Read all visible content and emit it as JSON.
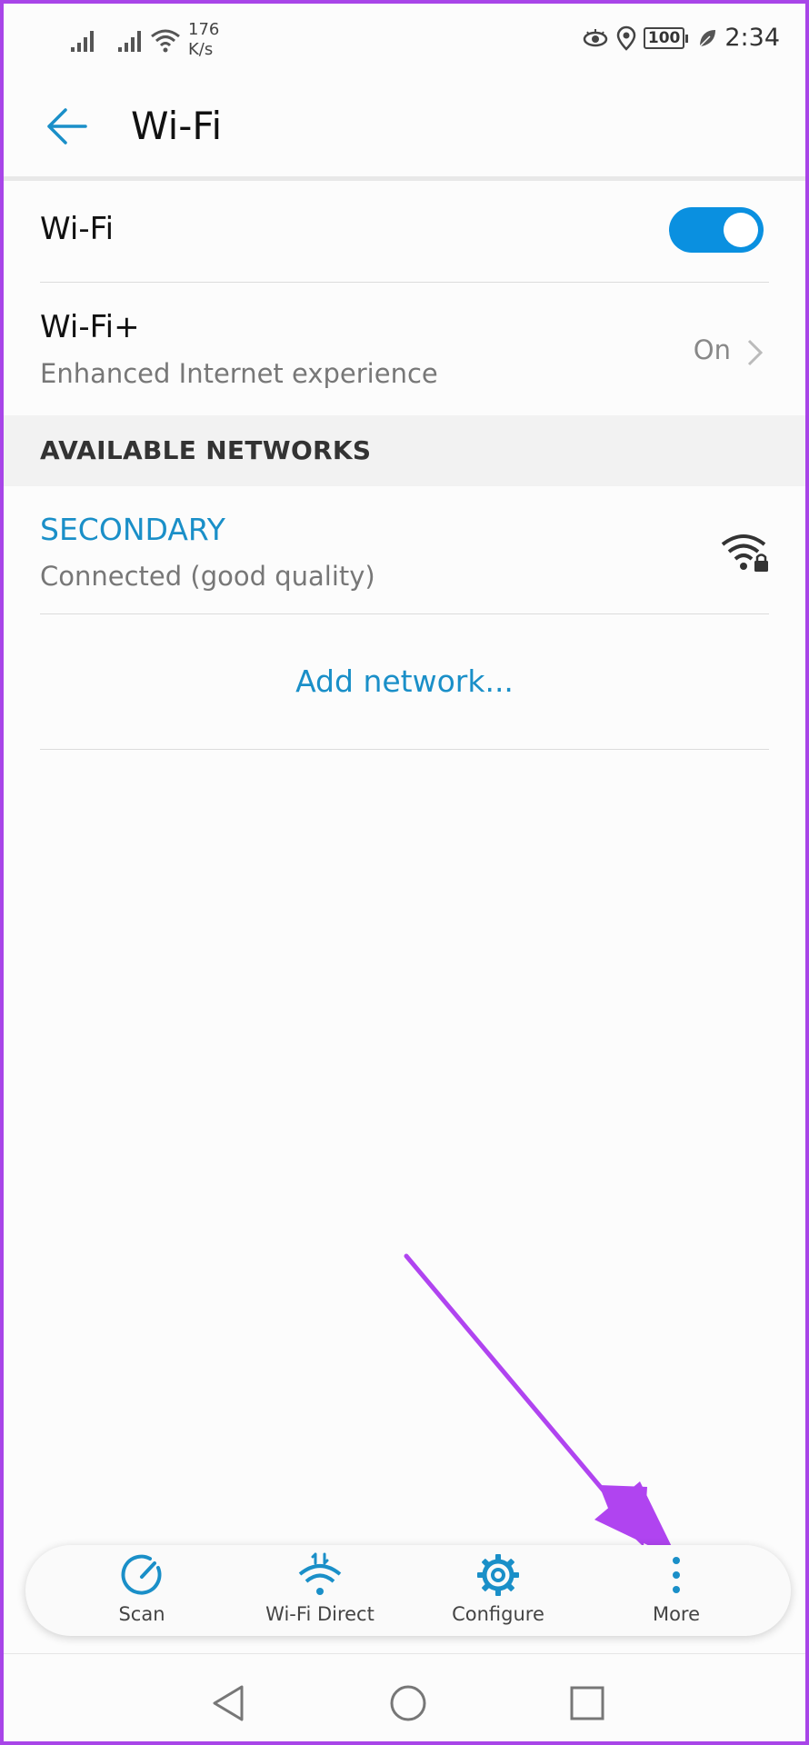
{
  "status_bar": {
    "network_speed_value": "176",
    "network_speed_unit": "K/s",
    "battery": "100",
    "time": "2:34"
  },
  "header": {
    "title": "Wi-Fi"
  },
  "wifi_toggle": {
    "label": "Wi-Fi",
    "state": "on"
  },
  "wifi_plus": {
    "label": "Wi-Fi+",
    "subtitle": "Enhanced Internet experience",
    "value": "On"
  },
  "available_networks": {
    "section_title": "AVAILABLE NETWORKS",
    "networks": [
      {
        "ssid": "SECONDARY",
        "status": "Connected (good quality)"
      }
    ],
    "add_network_label": "Add network..."
  },
  "action_bar": {
    "items": [
      {
        "label": "Scan",
        "icon": "scan-icon"
      },
      {
        "label": "Wi-Fi Direct",
        "icon": "wifi-direct-icon"
      },
      {
        "label": "Configure",
        "icon": "gear-icon"
      },
      {
        "label": "More",
        "icon": "more-vertical-icon"
      }
    ]
  },
  "colors": {
    "accent": "#1a8fc8",
    "toggle_on": "#0a90e0",
    "annotation_arrow": "#b044f0",
    "frame_border": "#a845e8"
  }
}
